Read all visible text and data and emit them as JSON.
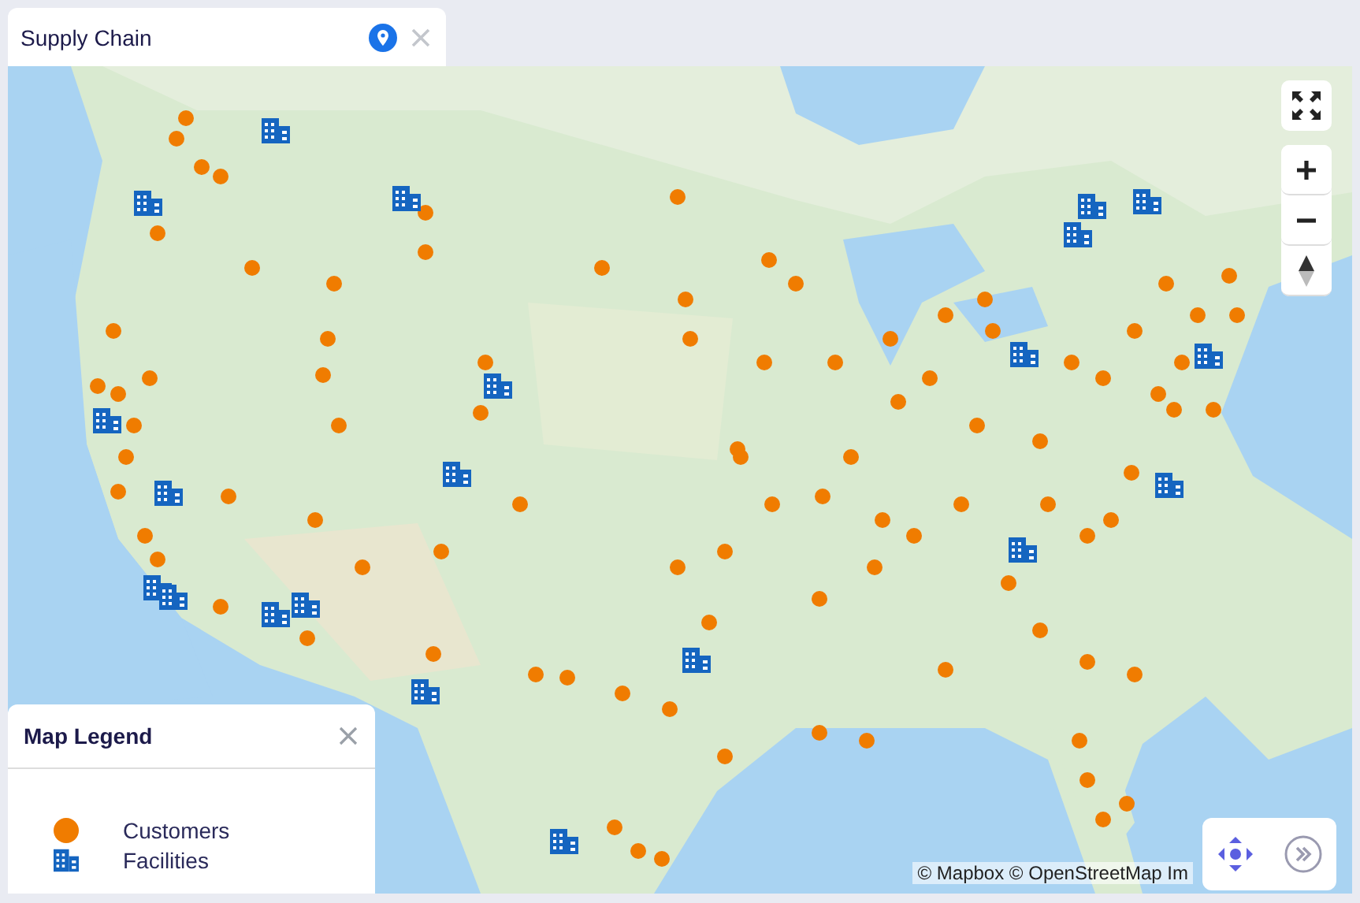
{
  "tab": {
    "title": "Supply Chain"
  },
  "legend": {
    "title": "Map Legend",
    "items": [
      {
        "label": "Customers",
        "kind": "customer"
      },
      {
        "label": "Facilities",
        "kind": "facility"
      }
    ]
  },
  "attribution": "© Mapbox © OpenStreetMap Im"
}
